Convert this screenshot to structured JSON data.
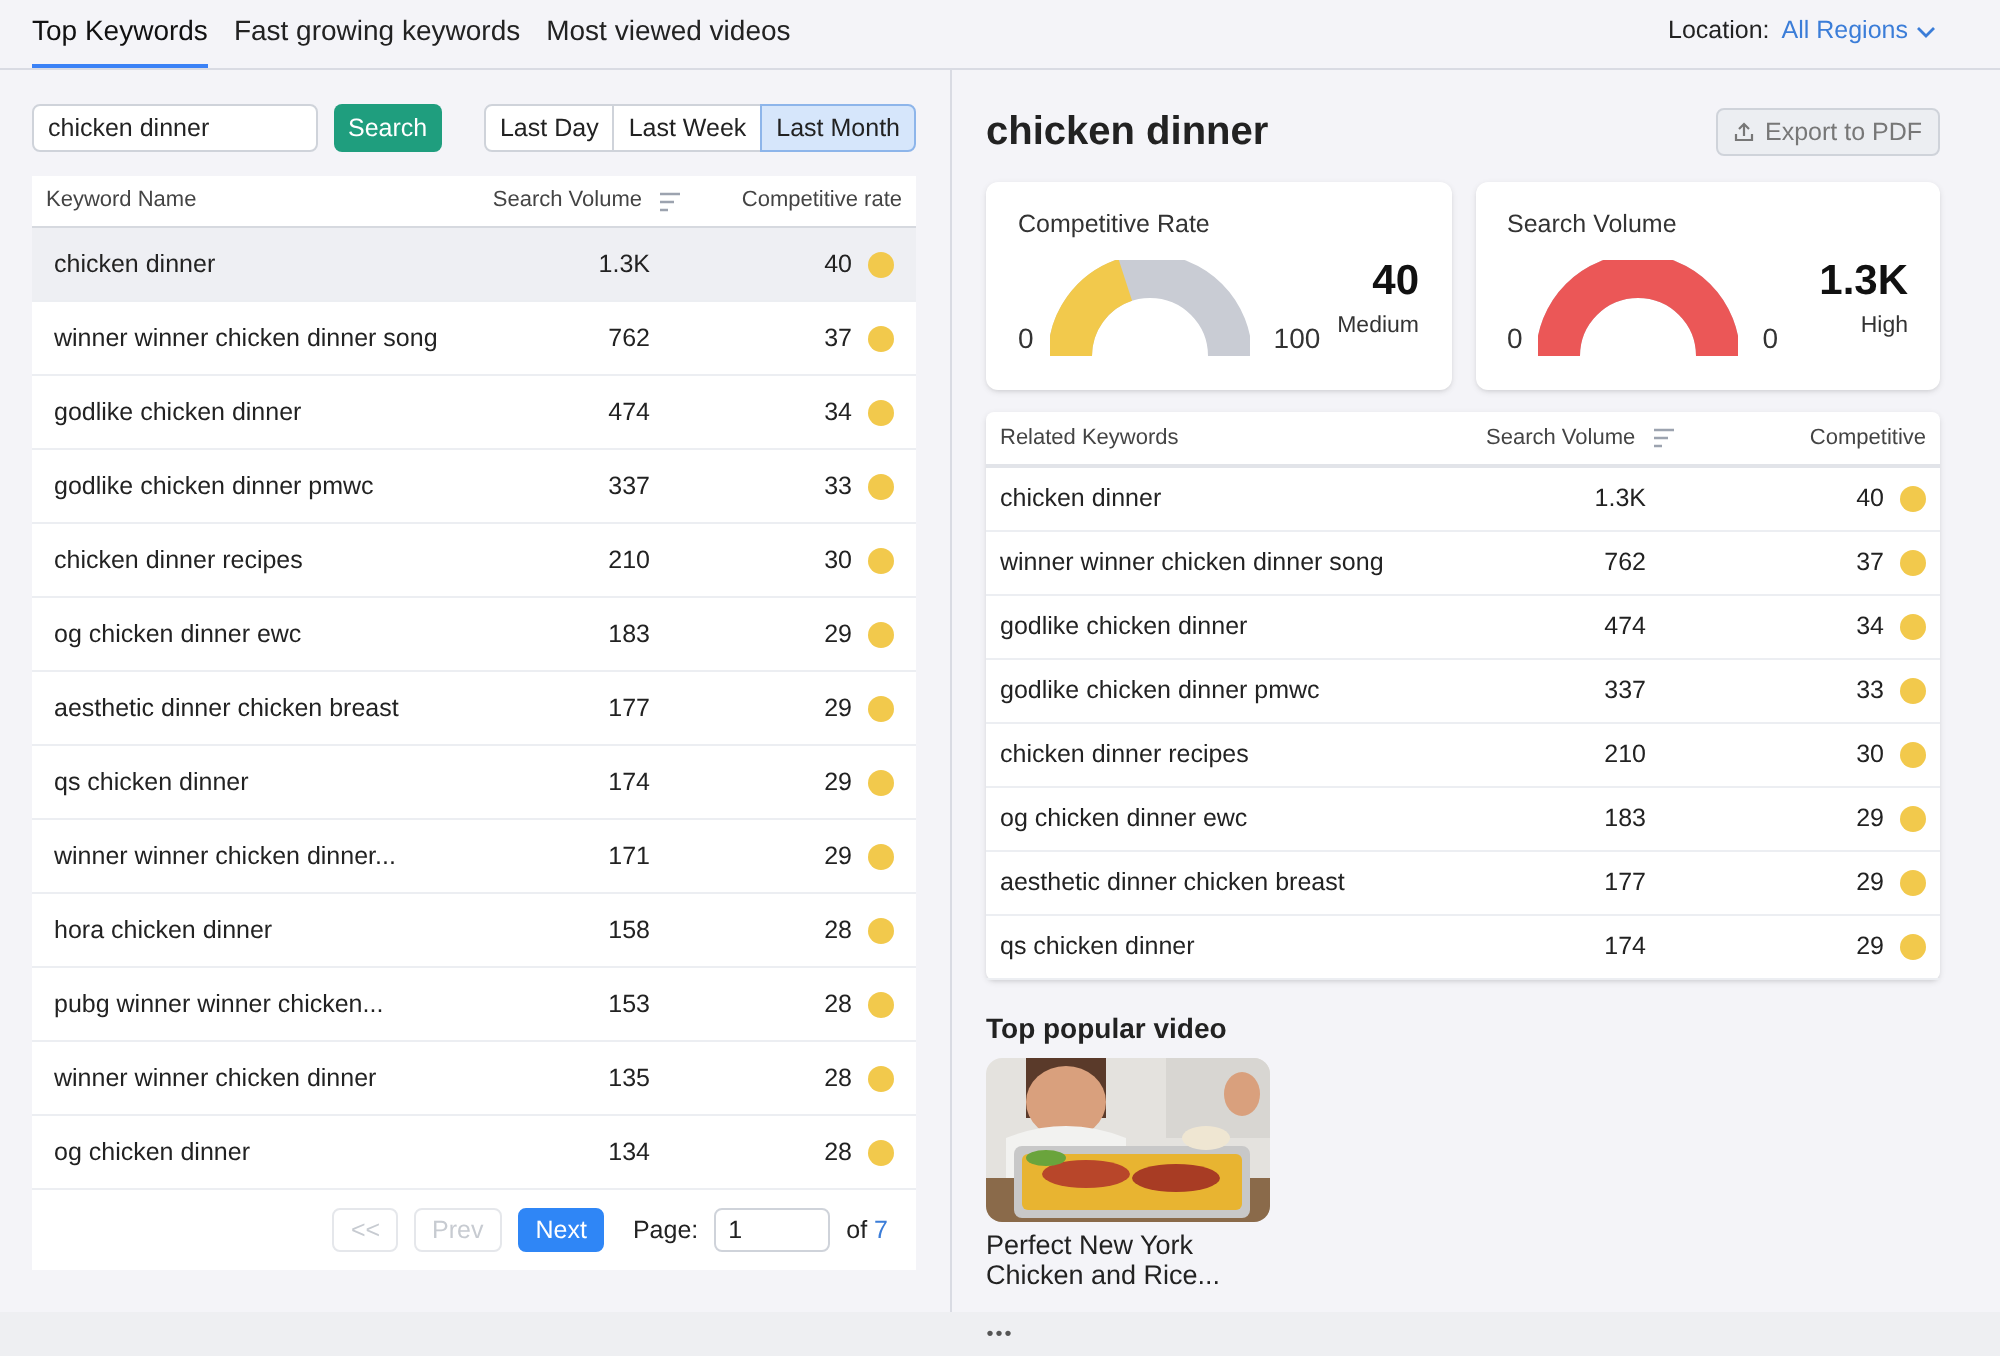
{
  "tabs": [
    {
      "label": "Top Keywords",
      "selected": true
    },
    {
      "label": "Fast growing keywords",
      "selected": false
    },
    {
      "label": "Most viewed videos",
      "selected": false
    }
  ],
  "location": {
    "label": "Location:",
    "value": "All Regions"
  },
  "search": {
    "value": "chicken dinner",
    "button": "Search"
  },
  "periods": [
    {
      "label": "Last Day",
      "selected": false
    },
    {
      "label": "Last Week",
      "selected": false
    },
    {
      "label": "Last Month",
      "selected": true
    }
  ],
  "table": {
    "columns": [
      "Keyword Name",
      "Search Volume",
      "Competitive rate"
    ],
    "rows": [
      {
        "keyword": "chicken dinner",
        "volume": "1.3K",
        "rate": "40",
        "selected": true
      },
      {
        "keyword": "winner winner chicken dinner song",
        "volume": "762",
        "rate": "37",
        "selected": false
      },
      {
        "keyword": "godlike chicken dinner",
        "volume": "474",
        "rate": "34",
        "selected": false
      },
      {
        "keyword": "godlike chicken dinner pmwc",
        "volume": "337",
        "rate": "33",
        "selected": false
      },
      {
        "keyword": "chicken dinner recipes",
        "volume": "210",
        "rate": "30",
        "selected": false
      },
      {
        "keyword": "og chicken dinner ewc",
        "volume": "183",
        "rate": "29",
        "selected": false
      },
      {
        "keyword": "aesthetic dinner chicken breast",
        "volume": "177",
        "rate": "29",
        "selected": false
      },
      {
        "keyword": "qs chicken dinner",
        "volume": "174",
        "rate": "29",
        "selected": false
      },
      {
        "keyword": "winner winner chicken dinner...",
        "volume": "171",
        "rate": "29",
        "selected": false
      },
      {
        "keyword": "hora chicken dinner",
        "volume": "158",
        "rate": "28",
        "selected": false
      },
      {
        "keyword": "pubg winner winner chicken...",
        "volume": "153",
        "rate": "28",
        "selected": false
      },
      {
        "keyword": "winner winner chicken dinner",
        "volume": "135",
        "rate": "28",
        "selected": false
      },
      {
        "keyword": "og chicken dinner",
        "volume": "134",
        "rate": "28",
        "selected": false
      }
    ]
  },
  "pagination": {
    "first": {
      "label": "<<",
      "disabled": true
    },
    "prev": {
      "label": "Prev",
      "disabled": true
    },
    "next": {
      "label": "Next",
      "disabled": false
    },
    "page_label": "Page:",
    "page": "1",
    "of": "of",
    "total": "7"
  },
  "detail": {
    "title": "chicken dinner",
    "export": "Export to PDF",
    "gauges": [
      {
        "title": "Competitive Rate",
        "min": "0",
        "max": "100",
        "value": "40",
        "rating": "Medium",
        "level": 0.4,
        "color": "#f2c94c"
      },
      {
        "title": "Search Volume",
        "min": "0",
        "max": "0",
        "value": "1.3K",
        "rating": "High",
        "level": 1,
        "color": "#eb5757"
      }
    ],
    "related": {
      "columns": [
        "Related Keywords",
        "Search Volume",
        "Competitive"
      ],
      "rows": [
        {
          "keyword": "chicken dinner",
          "volume": "1.3K",
          "rate": "40"
        },
        {
          "keyword": "winner winner chicken dinner song",
          "volume": "762",
          "rate": "37"
        },
        {
          "keyword": "godlike chicken dinner",
          "volume": "474",
          "rate": "34"
        },
        {
          "keyword": "godlike chicken dinner pmwc",
          "volume": "337",
          "rate": "33"
        },
        {
          "keyword": "chicken dinner recipes",
          "volume": "210",
          "rate": "30"
        },
        {
          "keyword": "og chicken dinner ewc",
          "volume": "183",
          "rate": "29"
        },
        {
          "keyword": "aesthetic dinner chicken breast",
          "volume": "177",
          "rate": "29"
        },
        {
          "keyword": "qs chicken dinner",
          "volume": "174",
          "rate": "29"
        }
      ]
    },
    "video_heading": "Top popular video",
    "video": {
      "kind": "picture",
      "title": "Perfect New York Chicken and Rice..."
    }
  },
  "bottom_bar": {
    "handle": "•••"
  }
}
